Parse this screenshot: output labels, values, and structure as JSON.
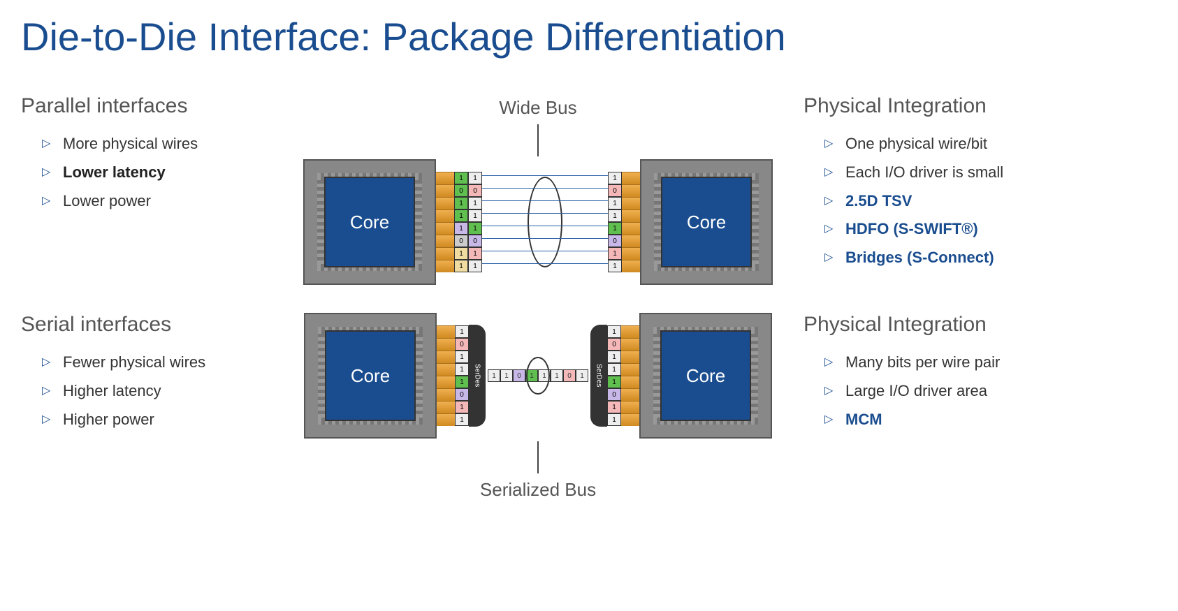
{
  "title": "Die-to-Die Interface: Package Differentiation",
  "parallel": {
    "heading": "Parallel interfaces",
    "bullets": [
      {
        "text": "More physical wires",
        "style": ""
      },
      {
        "text": "Lower latency",
        "style": "bold-dark"
      },
      {
        "text": "Lower power",
        "style": ""
      }
    ],
    "diagram_label": "Wide Bus",
    "core_label": "Core",
    "left_pins": [
      "1",
      "0",
      "1",
      "1",
      "1",
      "0",
      "1",
      "1"
    ],
    "right_pins": [
      "1",
      "0",
      "1",
      "1",
      "1",
      "0",
      "1",
      "1"
    ],
    "right_heading": "Physical Integration",
    "right_bullets": [
      {
        "text": "One physical wire/bit",
        "style": ""
      },
      {
        "text": "Each I/O driver is small",
        "style": ""
      },
      {
        "text": "2.5D TSV",
        "style": "bold-blue"
      },
      {
        "text": "HDFO (S-SWIFT®)",
        "style": "bold-blue"
      },
      {
        "text": "Bridges (S-Connect)",
        "style": "bold-blue"
      }
    ]
  },
  "serial": {
    "heading": "Serial interfaces",
    "bullets": [
      {
        "text": "Fewer physical wires",
        "style": ""
      },
      {
        "text": "Higher latency",
        "style": ""
      },
      {
        "text": "Higher power",
        "style": ""
      }
    ],
    "diagram_label": "Serialized Bus",
    "core_label": "Core",
    "serdes_label": "SerDes",
    "pins": [
      "1",
      "0",
      "1",
      "1",
      "1",
      "0",
      "1",
      "1"
    ],
    "stream_bits": [
      "1",
      "1",
      "0",
      "1",
      "1",
      "1",
      "0",
      "1"
    ],
    "right_heading": "Physical Integration",
    "right_bullets": [
      {
        "text": "Many bits per wire pair",
        "style": ""
      },
      {
        "text": "Large I/O driver area",
        "style": ""
      },
      {
        "text": "MCM",
        "style": "bold-blue"
      }
    ]
  },
  "colors": {
    "title": "#1a4d8f",
    "core": "#1a4d8f",
    "accent_green": "#5fbf4f",
    "accent_pink": "#f4b8b8"
  }
}
